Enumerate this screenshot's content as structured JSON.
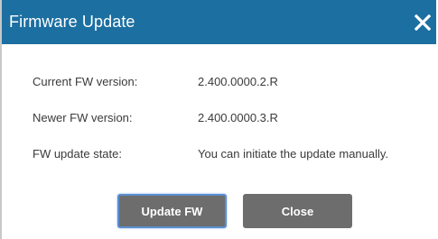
{
  "dialog": {
    "title": "Firmware Update",
    "close_icon": "close-icon"
  },
  "rows": [
    {
      "label": "Current FW version:",
      "value": "2.400.0000.2.R"
    },
    {
      "label": "Newer FW version:",
      "value": "2.400.0000.3.R"
    },
    {
      "label": "FW update state:",
      "value": "You can initiate the update manually."
    }
  ],
  "buttons": {
    "update_label": "Update FW",
    "close_label": "Close"
  },
  "colors": {
    "titlebar": "#1c6fa1",
    "button": "#6d6d6d",
    "focus_border": "#5a8fd0"
  }
}
